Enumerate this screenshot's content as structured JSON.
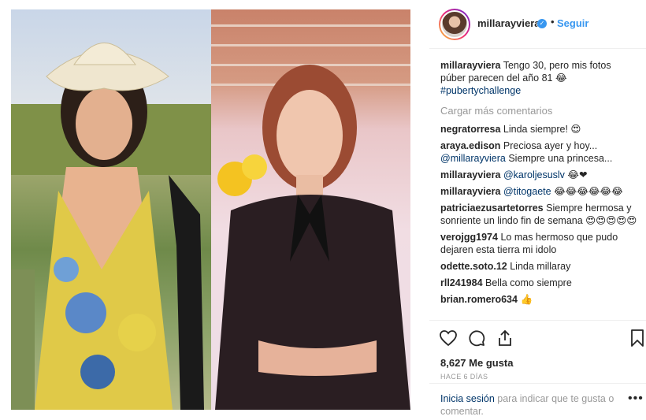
{
  "header": {
    "username": "millarayviera",
    "verified_badge": "✓",
    "separator": "•",
    "follow_label": "Seguir"
  },
  "caption": {
    "username": "millarayviera",
    "text": "Tengo 30, pero mis fotos púber parecen del año 81 😂",
    "hashtag": "#pubertychallenge"
  },
  "load_more_label": "Cargar más comentarios",
  "comments": [
    {
      "user": "negratorresa",
      "text": "Linda siempre! 😍"
    },
    {
      "user": "araya.edison",
      "text": "Preciosa ayer y hoy...",
      "mention": "@millarayviera",
      "after": "Siempre una princesa..."
    },
    {
      "user": "millarayviera",
      "mention": "@karoljesuslv",
      "after": "😂❤"
    },
    {
      "user": "millarayviera",
      "mention": "@titogaete",
      "after": "😂😂😂😂😂😂"
    },
    {
      "user": "patriciaezusartetorres",
      "text": "Siempre hermosa y sonriente un lindo fin de semana 😍😍😍😍😍"
    },
    {
      "user": "verojgg1974",
      "text": "Lo mas hermoso que pudo dejaren esta tierra mi idolo"
    },
    {
      "user": "odette.soto.12",
      "text": "Linda millaray"
    },
    {
      "user": "rll241984",
      "text": "Bella como siempre"
    },
    {
      "user": "brian.romero634",
      "text": "👍"
    }
  ],
  "likes": "8,627 Me gusta",
  "time_ago": "HACE 6 DÍAS",
  "login": {
    "link": "Inicia sesión",
    "text": "para indicar que te gusta o comentar."
  },
  "more_label": "•••",
  "icons": [
    "heart-icon",
    "comment-icon",
    "share-icon",
    "bookmark-icon"
  ]
}
